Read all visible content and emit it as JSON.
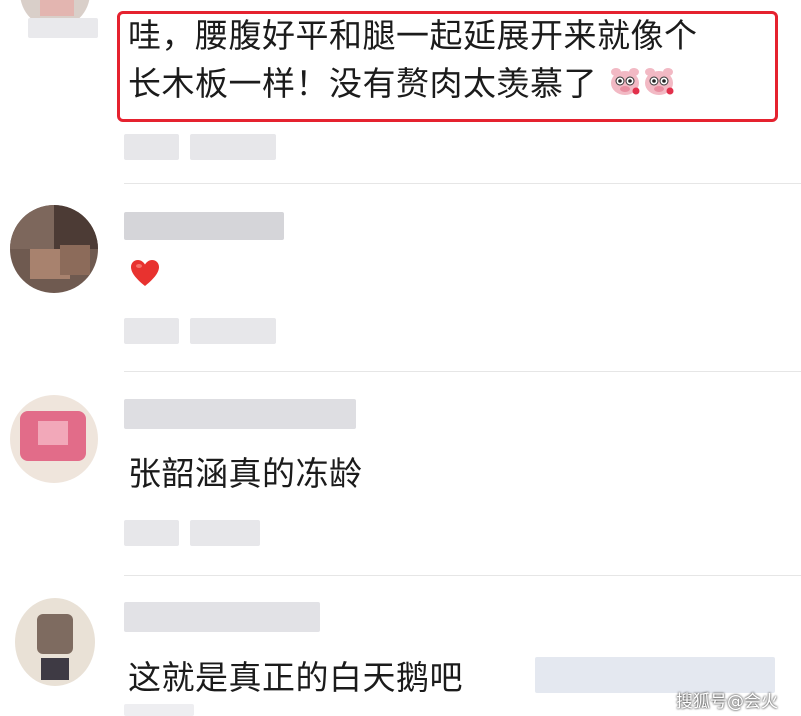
{
  "comments": [
    {
      "line1": "哇，腰腹好平和腿一起延展开来就像个",
      "line2": "长木板一样！没有赘肉太羡慕了",
      "emoji_icons": [
        "pig-face-icon",
        "pig-face-icon"
      ]
    },
    {
      "emoji_icon": "heart-icon",
      "emoji_glyph": "❤"
    },
    {
      "text": "张韶涵真的冻龄"
    },
    {
      "text": "这就是真正的白天鹅吧"
    }
  ],
  "watermark": "搜狐号@会火",
  "colors": {
    "highlight_border": "#e5222f",
    "heart": "#e8322f",
    "divider": "#e6e6e6"
  }
}
